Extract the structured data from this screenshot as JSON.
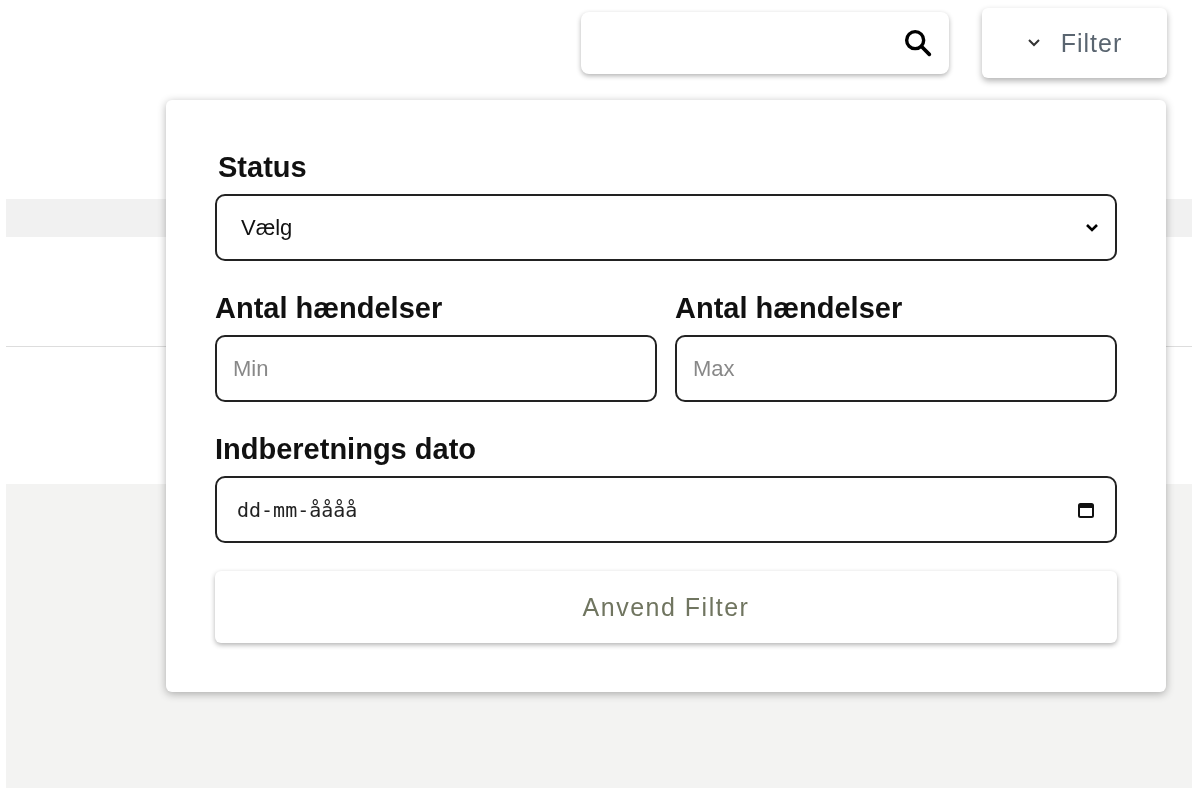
{
  "filter_button": {
    "label": "Filter",
    "expanded": true
  },
  "filter_panel": {
    "status": {
      "label": "Status",
      "value": "Vælg"
    },
    "ranges": [
      {
        "label": "Antal hændelser",
        "placeholder": "Min"
      },
      {
        "label": "Antal hændelser",
        "placeholder": "Max"
      }
    ],
    "date": {
      "label": "Indberetnings dato",
      "placeholder": "dd-mm-åååå"
    },
    "apply_button": "Anvend Filter"
  }
}
